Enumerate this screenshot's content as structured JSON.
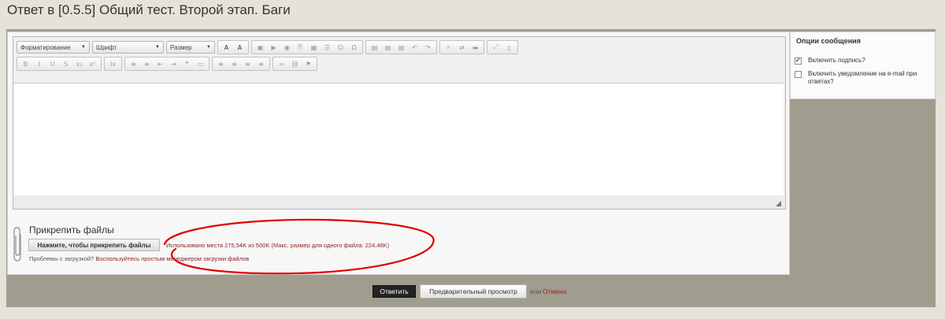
{
  "page": {
    "title": "Ответ в [0.5.5] Общий тест. Второй этап. Баги"
  },
  "editor": {
    "toolbar": {
      "format_label": "Форматирование",
      "font_label": "Шрифт",
      "size_label": "Размер",
      "row1_groups": [
        [
          "text-color-icon",
          "bg-color-icon"
        ],
        [
          "image-icon",
          "flash-icon",
          "media-icon",
          "link-icon",
          "table-icon",
          "hr-icon",
          "smiley-icon",
          "special-char-icon"
        ],
        [
          "paste-icon",
          "paste-text-icon",
          "paste-word-icon",
          "undo-icon",
          "redo-icon"
        ],
        [
          "find-icon",
          "replace-icon",
          "select-all-icon"
        ],
        [
          "maximize-icon",
          "show-blocks-icon"
        ]
      ],
      "row1_glyphs": [
        [
          "A",
          "A"
        ],
        [
          "▣",
          "▶",
          "◉",
          "⎘",
          "▦",
          "☰",
          "☺",
          "Ω"
        ],
        [
          "▤",
          "▤",
          "▤",
          "↶",
          "↷"
        ],
        [
          "⌕",
          "⇄",
          "▬"
        ],
        [
          "⤢",
          "▯"
        ]
      ],
      "row2_groups": [
        [
          "bold-icon",
          "italic-icon",
          "underline-icon",
          "strike-icon",
          "subscript-icon",
          "superscript-icon"
        ],
        [
          "remove-format-icon"
        ],
        [
          "numbered-list-icon",
          "bullet-list-icon",
          "outdent-icon",
          "indent-icon",
          "blockquote-icon",
          "create-div-icon"
        ],
        [
          "align-left-icon",
          "align-center-icon",
          "align-right-icon",
          "justify-icon"
        ],
        [
          "link-icon",
          "unlink-icon",
          "anchor-icon"
        ]
      ],
      "row2_glyphs": [
        [
          "B",
          "I",
          "U",
          "S",
          "x₂",
          "x²"
        ],
        [
          "Ix"
        ],
        [
          "≡",
          "≡",
          "⇤",
          "⇥",
          "❞",
          "▭"
        ],
        [
          "≡",
          "≡",
          "≡",
          "≡"
        ],
        [
          "∞",
          "⛓",
          "⚑"
        ]
      ]
    }
  },
  "options": {
    "title": "Опции сообщения",
    "items": [
      {
        "label": "Включить подпись?",
        "checked": true
      },
      {
        "label": "Включить уведомление на e-mail при ответах?",
        "checked": false
      }
    ]
  },
  "attachments": {
    "title": "Прикрепить файлы",
    "button_label": "Нажмите, чтобы прикрепить файлы",
    "quota_text": "Использовано места 275,54K из 500K (Макс. размер для одного файла: 224,46K)",
    "problems_prefix": "Проблемы с загрузкой?",
    "problems_link": "Воспользуйтесь простым менеджером загрузки файлов"
  },
  "actions": {
    "reply_label": "Ответить",
    "preview_label": "Предварительный просмотр",
    "or_text": "или",
    "cancel_label": "Отмена"
  },
  "colors": {
    "annotation": "#e00000",
    "frame": "#a19d8e",
    "page_bg": "#e4e2d9"
  }
}
